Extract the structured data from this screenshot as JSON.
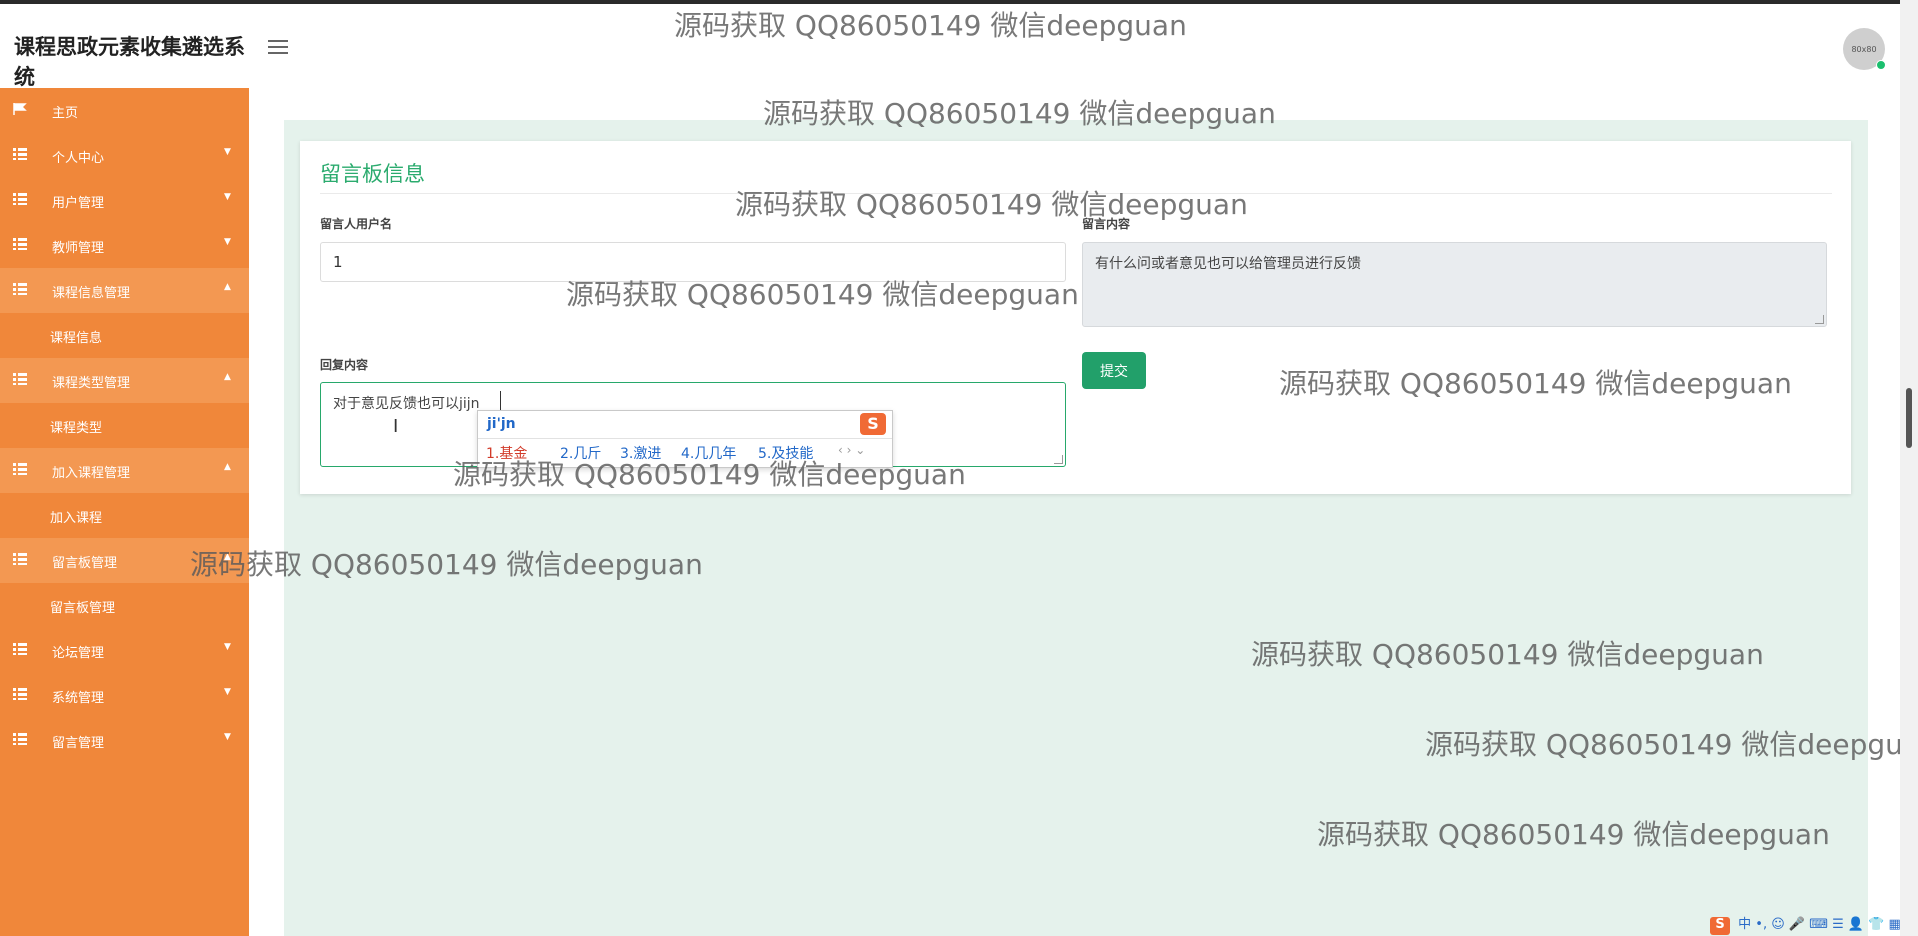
{
  "app": {
    "title": "课程思政元素收集遴选系统",
    "avatar_text": "80x80"
  },
  "sidebar": {
    "items": [
      {
        "label": "主页",
        "icon": "flag-icon",
        "chevron": ""
      },
      {
        "label": "个人中心",
        "icon": "grid-icon",
        "chevron": "▼"
      },
      {
        "label": "用户管理",
        "icon": "grid-icon",
        "chevron": "▼"
      },
      {
        "label": "教师管理",
        "icon": "grid-icon",
        "chevron": "▼"
      },
      {
        "label": "课程信息管理",
        "icon": "grid-icon",
        "chevron": "▲"
      },
      {
        "label": "课程信息"
      },
      {
        "label": "课程类型管理",
        "icon": "grid-icon",
        "chevron": "▲"
      },
      {
        "label": "课程类型"
      },
      {
        "label": "加入课程管理",
        "icon": "grid-icon",
        "chevron": "▲"
      },
      {
        "label": "加入课程"
      },
      {
        "label": "留言板管理",
        "icon": "grid-icon",
        "chevron": "▲"
      },
      {
        "label": "留言板管理"
      },
      {
        "label": "论坛管理",
        "icon": "grid-icon",
        "chevron": "▼"
      },
      {
        "label": "系统管理",
        "icon": "grid-icon",
        "chevron": "▼"
      },
      {
        "label": "留言管理",
        "icon": "grid-icon",
        "chevron": "▼"
      }
    ]
  },
  "form": {
    "title": "留言板信息",
    "username_label": "留言人用户名",
    "username_value": "1",
    "content_label": "留言内容",
    "content_value": "有什么问或者意见也可以给管理员进行反馈",
    "reply_label": "回复内容",
    "reply_value": "对于意见反馈也可以jijn",
    "submit_label": "提交"
  },
  "ime": {
    "composition": "ji'jn",
    "candidates": [
      "1.基金",
      "2.几斤",
      "3.激进",
      "4.几几年",
      "5.及技能"
    ],
    "logo": "S",
    "arrows": "‹ › ⌄"
  },
  "watermark": {
    "text": "源码获取 QQ86050149 微信deepguan",
    "text_cut": "源码获取 QQ86050149 微信deepgu"
  },
  "tray": {
    "logo": "S",
    "text": "中 •, ☺ 🎤 ⌨ ☰ 👤 👕 ▦"
  }
}
